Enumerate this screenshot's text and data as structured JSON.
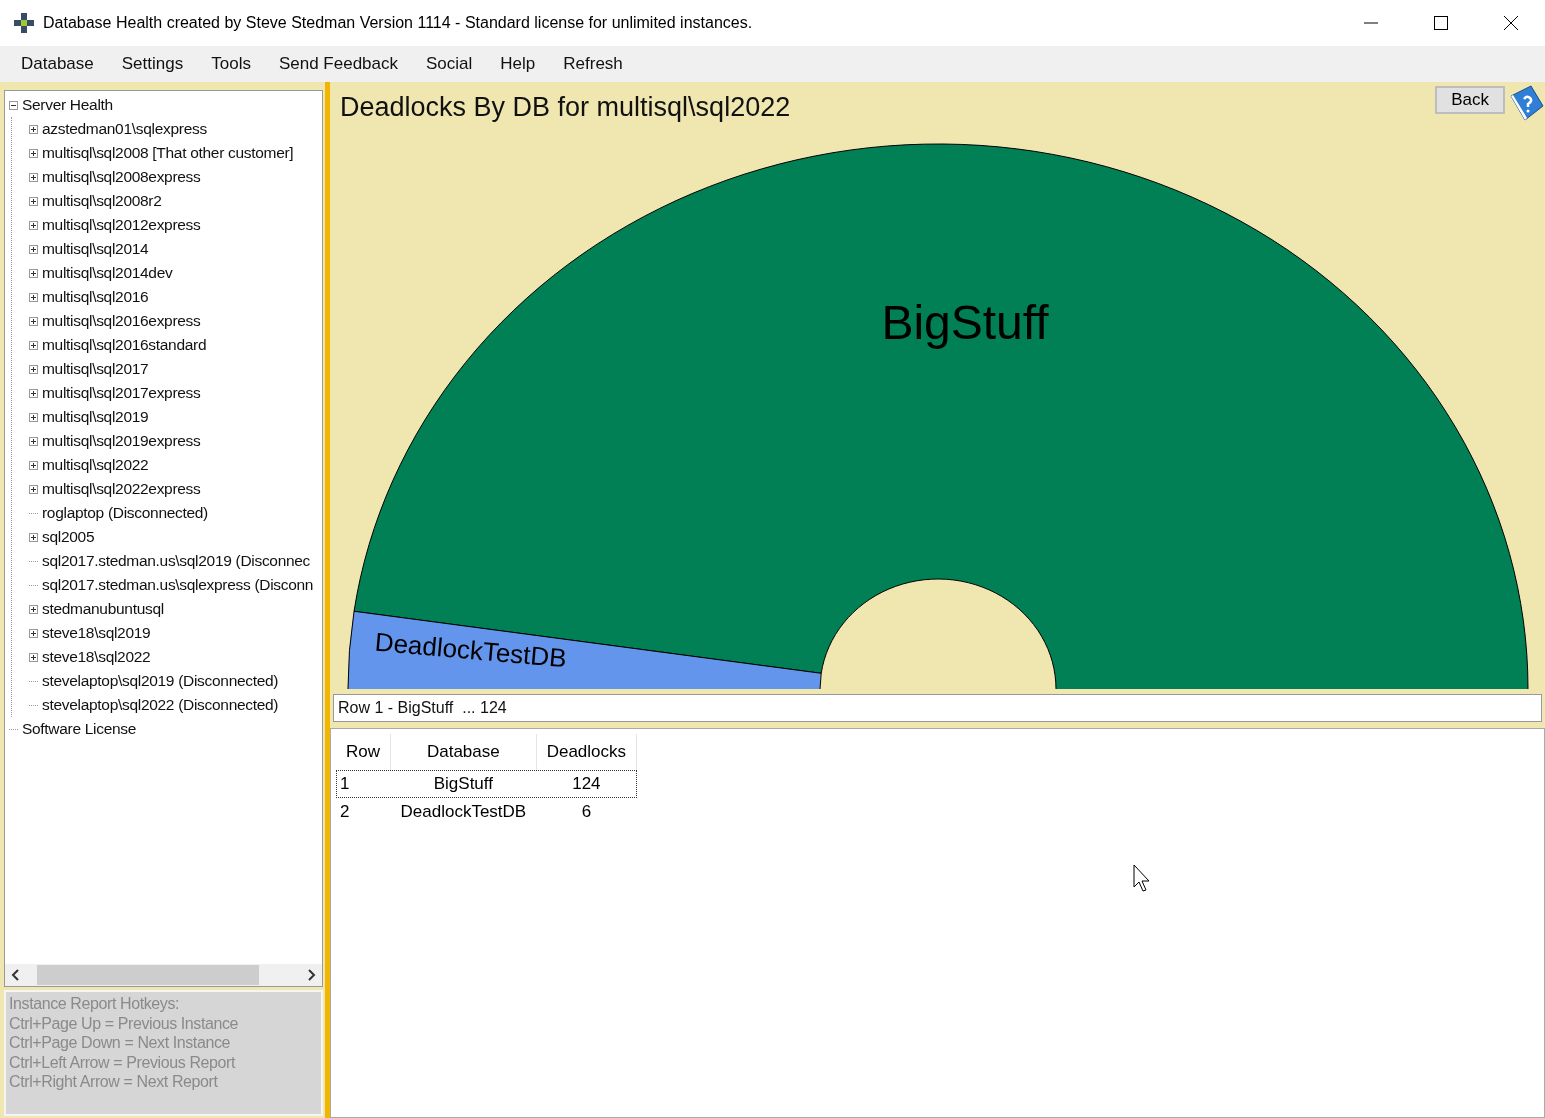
{
  "window": {
    "title": "Database Health created by Steve Stedman Version 1114 - Standard license for unlimited instances."
  },
  "menu": [
    "Database",
    "Settings",
    "Tools",
    "Send Feedback",
    "Social",
    "Help",
    "Refresh"
  ],
  "tree": [
    {
      "label": "Server Health",
      "kind": "expanded",
      "children": [
        {
          "label": "azstedman01\\sqlexpress",
          "kind": "collapsed"
        },
        {
          "label": "multisql\\sql2008  [That other customer]",
          "kind": "collapsed"
        },
        {
          "label": "multisql\\sql2008express",
          "kind": "collapsed"
        },
        {
          "label": "multisql\\sql2008r2",
          "kind": "collapsed"
        },
        {
          "label": "multisql\\sql2012express",
          "kind": "collapsed"
        },
        {
          "label": "multisql\\sql2014",
          "kind": "collapsed"
        },
        {
          "label": "multisql\\sql2014dev",
          "kind": "collapsed"
        },
        {
          "label": "multisql\\sql2016",
          "kind": "collapsed"
        },
        {
          "label": "multisql\\sql2016express",
          "kind": "collapsed"
        },
        {
          "label": "multisql\\sql2016standard",
          "kind": "collapsed"
        },
        {
          "label": "multisql\\sql2017",
          "kind": "collapsed"
        },
        {
          "label": "multisql\\sql2017express",
          "kind": "collapsed"
        },
        {
          "label": "multisql\\sql2019",
          "kind": "collapsed"
        },
        {
          "label": "multisql\\sql2019express",
          "kind": "collapsed"
        },
        {
          "label": "multisql\\sql2022",
          "kind": "collapsed"
        },
        {
          "label": "multisql\\sql2022express",
          "kind": "collapsed"
        },
        {
          "label": "roglaptop (Disconnected)",
          "kind": "leaf"
        },
        {
          "label": "sql2005",
          "kind": "collapsed"
        },
        {
          "label": "sql2017.stedman.us\\sql2019 (Disconnec",
          "kind": "leaf"
        },
        {
          "label": "sql2017.stedman.us\\sqlexpress (Disconn",
          "kind": "leaf"
        },
        {
          "label": "stedmanubuntusql",
          "kind": "collapsed"
        },
        {
          "label": "steve18\\sql2019",
          "kind": "collapsed"
        },
        {
          "label": "steve18\\sql2022",
          "kind": "collapsed"
        },
        {
          "label": "stevelaptop\\sql2019 (Disconnected)",
          "kind": "leaf"
        },
        {
          "label": "stevelaptop\\sql2022 (Disconnected)",
          "kind": "leaf"
        }
      ]
    },
    {
      "label": "Software License",
      "kind": "leaf"
    }
  ],
  "hotkeys": [
    "Instance Report Hotkeys:",
    "Ctrl+Page Up = Previous Instance",
    "Ctrl+Page Down = Next Instance",
    "Ctrl+Left Arrow = Previous Report",
    "Ctrl+Right Arrow = Next Report"
  ],
  "report": {
    "title": "Deadlocks By DB for multisql\\sql2022",
    "back_button": "Back",
    "chart_slices": [
      {
        "label": "BigStuff",
        "color": "#008054"
      },
      {
        "label": "DeadlockTestDB",
        "color": "#6495ed"
      }
    ],
    "status": "Row 1 - BigStuff  ... 124"
  },
  "table": {
    "columns": [
      "Row",
      "Database",
      "Deadlocks"
    ],
    "rows": [
      {
        "cells": [
          "1",
          "BigStuff",
          "124"
        ],
        "selected": true
      },
      {
        "cells": [
          "2",
          "DeadlockTestDB",
          "6"
        ],
        "selected": false
      }
    ]
  }
}
